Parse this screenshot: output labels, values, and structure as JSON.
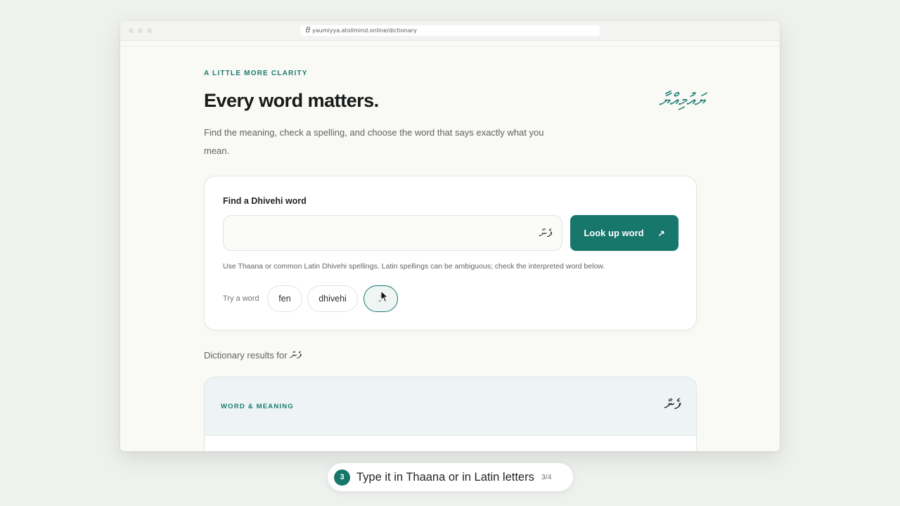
{
  "browser": {
    "url": "yaumiyya.atollmind.online/dictionary"
  },
  "hero": {
    "eyebrow": "A LITTLE MORE CLARITY",
    "title": "Every word matters.",
    "logo_text": "ޔައުމިއްޔާ",
    "description": "Find the meaning, check a spelling, and choose the word that says exactly what you mean."
  },
  "search": {
    "label": "Find a Dhivehi word",
    "value": "ފެން",
    "placeholder": "",
    "button_label": "Look up word",
    "hint": "Use Thaana or common Latin Dhivehi spellings. Latin spellings can be ambiguous; check the interpreted word below.",
    "try_label": "Try a word",
    "suggestions": [
      "fen",
      "dhivehi",
      "ފެ"
    ]
  },
  "results": {
    "label": "Dictionary results for",
    "query": "ފެން",
    "card_eyebrow": "WORD & MEANING",
    "card_word": "ފެން"
  },
  "tour": {
    "step_number": "3",
    "step_text": "Type it in Thaana or in Latin letters",
    "step_count": "3/4"
  },
  "colors": {
    "accent": "#17776b",
    "result_bg": "#eef4f5"
  }
}
